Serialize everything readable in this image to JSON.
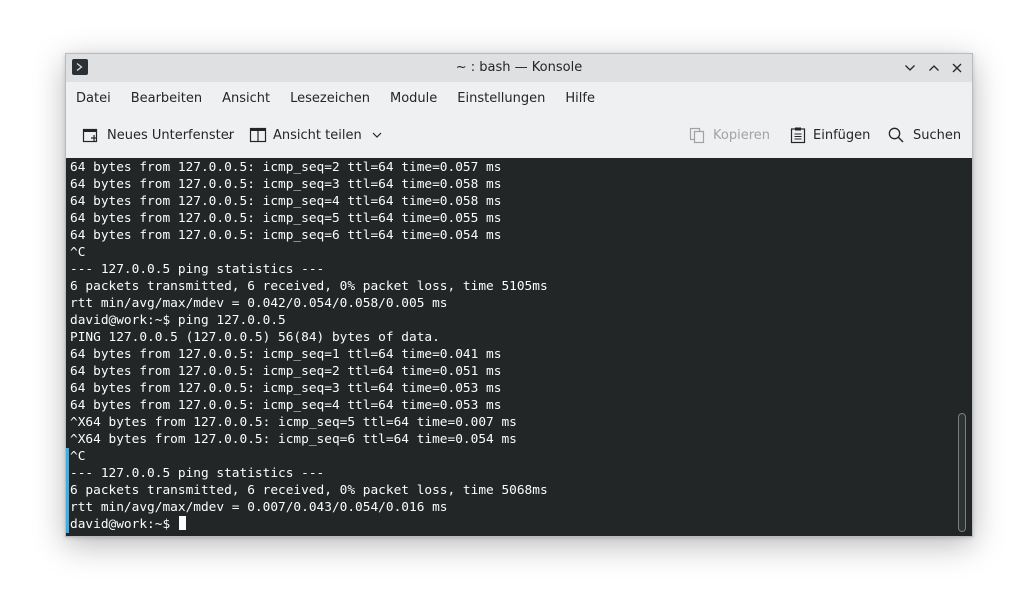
{
  "window": {
    "title": "~ : bash — Konsole"
  },
  "menu": [
    "Datei",
    "Bearbeiten",
    "Ansicht",
    "Lesezeichen",
    "Module",
    "Einstellungen",
    "Hilfe"
  ],
  "toolbar": {
    "new_tab": "Neues Unterfenster",
    "split_view": "Ansicht teilen",
    "copy": "Kopieren",
    "paste": "Einfügen",
    "find": "Suchen"
  },
  "terminal": {
    "lines": [
      "64 bytes from 127.0.0.5: icmp_seq=2 ttl=64 time=0.057 ms",
      "64 bytes from 127.0.0.5: icmp_seq=3 ttl=64 time=0.058 ms",
      "64 bytes from 127.0.0.5: icmp_seq=4 ttl=64 time=0.058 ms",
      "64 bytes from 127.0.0.5: icmp_seq=5 ttl=64 time=0.055 ms",
      "64 bytes from 127.0.0.5: icmp_seq=6 ttl=64 time=0.054 ms",
      "^C",
      "--- 127.0.0.5 ping statistics ---",
      "6 packets transmitted, 6 received, 0% packet loss, time 5105ms",
      "rtt min/avg/max/mdev = 0.042/0.054/0.058/0.005 ms",
      "david@work:~$ ping 127.0.0.5",
      "PING 127.0.0.5 (127.0.0.5) 56(84) bytes of data.",
      "64 bytes from 127.0.0.5: icmp_seq=1 ttl=64 time=0.041 ms",
      "64 bytes from 127.0.0.5: icmp_seq=2 ttl=64 time=0.051 ms",
      "64 bytes from 127.0.0.5: icmp_seq=3 ttl=64 time=0.053 ms",
      "64 bytes from 127.0.0.5: icmp_seq=4 ttl=64 time=0.053 ms",
      "^X64 bytes from 127.0.0.5: icmp_seq=5 ttl=64 time=0.007 ms",
      "^X64 bytes from 127.0.0.5: icmp_seq=6 ttl=64 time=0.054 ms",
      "^C",
      "--- 127.0.0.5 ping statistics ---",
      "6 packets transmitted, 6 received, 0% packet loss, time 5068ms",
      "rtt min/avg/max/mdev = 0.007/0.043/0.054/0.016 ms"
    ],
    "prompt": "david@work:~$ "
  },
  "colors": {
    "terminal_bg": "#232627",
    "terminal_fg": "#fcfcfc",
    "accent": "#3daee9",
    "chrome": "#eff0f1",
    "disabled": "#a0a2a4"
  },
  "icons": {
    "app": "terminal-icon",
    "minimize": "chevron-down-icon",
    "maximize": "chevron-up-icon",
    "close": "close-icon",
    "new_tab": "new-tab-icon",
    "split_view": "split-view-icon",
    "copy": "copy-icon",
    "paste": "paste-icon",
    "find": "search-icon"
  }
}
